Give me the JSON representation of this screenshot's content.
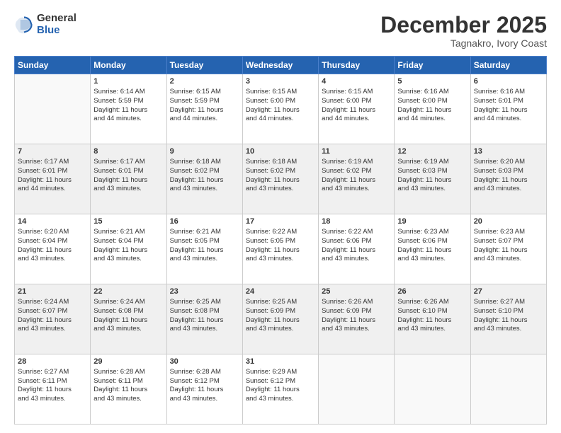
{
  "header": {
    "logo_line1": "General",
    "logo_line2": "Blue",
    "month": "December 2025",
    "location": "Tagnakro, Ivory Coast"
  },
  "weekdays": [
    "Sunday",
    "Monday",
    "Tuesday",
    "Wednesday",
    "Thursday",
    "Friday",
    "Saturday"
  ],
  "weeks": [
    [
      {
        "day": "",
        "info": ""
      },
      {
        "day": "1",
        "info": "Sunrise: 6:14 AM\nSunset: 5:59 PM\nDaylight: 11 hours\nand 44 minutes."
      },
      {
        "day": "2",
        "info": "Sunrise: 6:15 AM\nSunset: 5:59 PM\nDaylight: 11 hours\nand 44 minutes."
      },
      {
        "day": "3",
        "info": "Sunrise: 6:15 AM\nSunset: 6:00 PM\nDaylight: 11 hours\nand 44 minutes."
      },
      {
        "day": "4",
        "info": "Sunrise: 6:15 AM\nSunset: 6:00 PM\nDaylight: 11 hours\nand 44 minutes."
      },
      {
        "day": "5",
        "info": "Sunrise: 6:16 AM\nSunset: 6:00 PM\nDaylight: 11 hours\nand 44 minutes."
      },
      {
        "day": "6",
        "info": "Sunrise: 6:16 AM\nSunset: 6:01 PM\nDaylight: 11 hours\nand 44 minutes."
      }
    ],
    [
      {
        "day": "7",
        "info": "Sunrise: 6:17 AM\nSunset: 6:01 PM\nDaylight: 11 hours\nand 44 minutes."
      },
      {
        "day": "8",
        "info": "Sunrise: 6:17 AM\nSunset: 6:01 PM\nDaylight: 11 hours\nand 43 minutes."
      },
      {
        "day": "9",
        "info": "Sunrise: 6:18 AM\nSunset: 6:02 PM\nDaylight: 11 hours\nand 43 minutes."
      },
      {
        "day": "10",
        "info": "Sunrise: 6:18 AM\nSunset: 6:02 PM\nDaylight: 11 hours\nand 43 minutes."
      },
      {
        "day": "11",
        "info": "Sunrise: 6:19 AM\nSunset: 6:02 PM\nDaylight: 11 hours\nand 43 minutes."
      },
      {
        "day": "12",
        "info": "Sunrise: 6:19 AM\nSunset: 6:03 PM\nDaylight: 11 hours\nand 43 minutes."
      },
      {
        "day": "13",
        "info": "Sunrise: 6:20 AM\nSunset: 6:03 PM\nDaylight: 11 hours\nand 43 minutes."
      }
    ],
    [
      {
        "day": "14",
        "info": "Sunrise: 6:20 AM\nSunset: 6:04 PM\nDaylight: 11 hours\nand 43 minutes."
      },
      {
        "day": "15",
        "info": "Sunrise: 6:21 AM\nSunset: 6:04 PM\nDaylight: 11 hours\nand 43 minutes."
      },
      {
        "day": "16",
        "info": "Sunrise: 6:21 AM\nSunset: 6:05 PM\nDaylight: 11 hours\nand 43 minutes."
      },
      {
        "day": "17",
        "info": "Sunrise: 6:22 AM\nSunset: 6:05 PM\nDaylight: 11 hours\nand 43 minutes."
      },
      {
        "day": "18",
        "info": "Sunrise: 6:22 AM\nSunset: 6:06 PM\nDaylight: 11 hours\nand 43 minutes."
      },
      {
        "day": "19",
        "info": "Sunrise: 6:23 AM\nSunset: 6:06 PM\nDaylight: 11 hours\nand 43 minutes."
      },
      {
        "day": "20",
        "info": "Sunrise: 6:23 AM\nSunset: 6:07 PM\nDaylight: 11 hours\nand 43 minutes."
      }
    ],
    [
      {
        "day": "21",
        "info": "Sunrise: 6:24 AM\nSunset: 6:07 PM\nDaylight: 11 hours\nand 43 minutes."
      },
      {
        "day": "22",
        "info": "Sunrise: 6:24 AM\nSunset: 6:08 PM\nDaylight: 11 hours\nand 43 minutes."
      },
      {
        "day": "23",
        "info": "Sunrise: 6:25 AM\nSunset: 6:08 PM\nDaylight: 11 hours\nand 43 minutes."
      },
      {
        "day": "24",
        "info": "Sunrise: 6:25 AM\nSunset: 6:09 PM\nDaylight: 11 hours\nand 43 minutes."
      },
      {
        "day": "25",
        "info": "Sunrise: 6:26 AM\nSunset: 6:09 PM\nDaylight: 11 hours\nand 43 minutes."
      },
      {
        "day": "26",
        "info": "Sunrise: 6:26 AM\nSunset: 6:10 PM\nDaylight: 11 hours\nand 43 minutes."
      },
      {
        "day": "27",
        "info": "Sunrise: 6:27 AM\nSunset: 6:10 PM\nDaylight: 11 hours\nand 43 minutes."
      }
    ],
    [
      {
        "day": "28",
        "info": "Sunrise: 6:27 AM\nSunset: 6:11 PM\nDaylight: 11 hours\nand 43 minutes."
      },
      {
        "day": "29",
        "info": "Sunrise: 6:28 AM\nSunset: 6:11 PM\nDaylight: 11 hours\nand 43 minutes."
      },
      {
        "day": "30",
        "info": "Sunrise: 6:28 AM\nSunset: 6:12 PM\nDaylight: 11 hours\nand 43 minutes."
      },
      {
        "day": "31",
        "info": "Sunrise: 6:29 AM\nSunset: 6:12 PM\nDaylight: 11 hours\nand 43 minutes."
      },
      {
        "day": "",
        "info": ""
      },
      {
        "day": "",
        "info": ""
      },
      {
        "day": "",
        "info": ""
      }
    ]
  ]
}
